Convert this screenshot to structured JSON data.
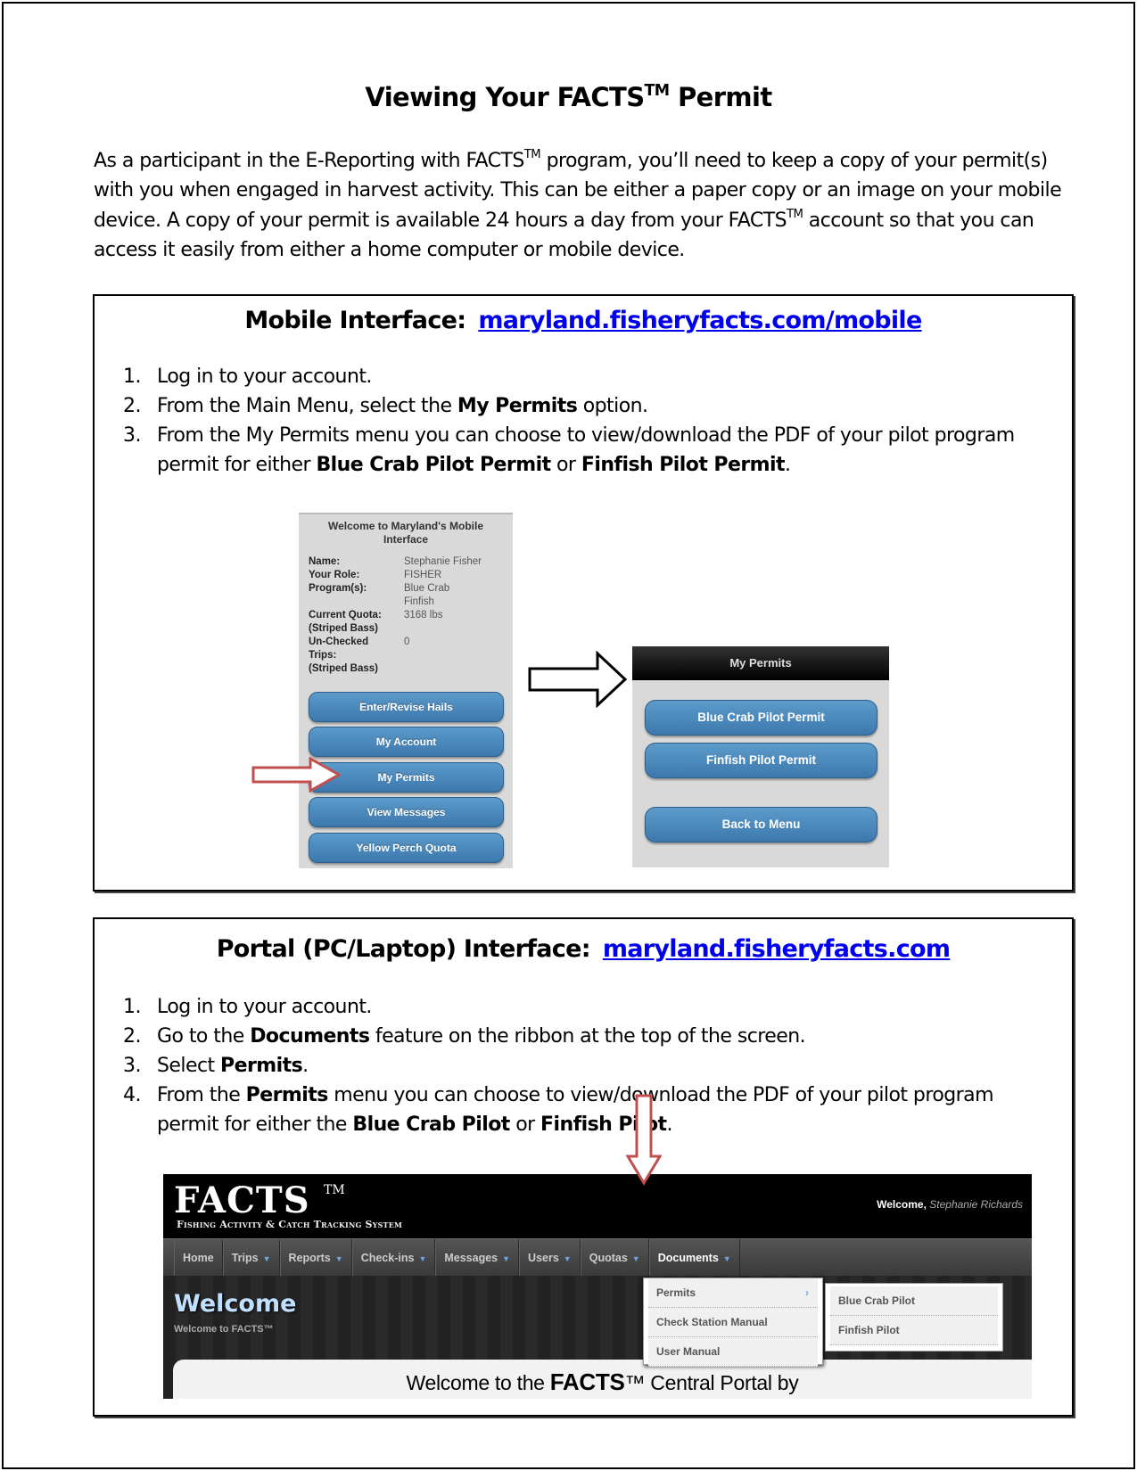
{
  "title": {
    "text": "Viewing Your FACTS",
    "tm": "TM",
    "suffix": " Permit"
  },
  "intro": {
    "p1": "As a participant in the E-Reporting with FACTS",
    "tm": "TM",
    "p2": " program, you’ll need to keep a copy of your permit(s) with you when engaged in harvest activity.  This can be either a paper copy or an image on your mobile device.  A copy of your permit is available 24 hours a day from your FACTS",
    "p3": " account so that you can access it easily from either a home computer or mobile device."
  },
  "mobile": {
    "heading": "Mobile Interface:",
    "link": "maryland.fisheryfacts.com/mobile",
    "steps": [
      {
        "num": "1.",
        "text": "Log in to your account."
      },
      {
        "num": "2.",
        "a": "From the Main Menu, select the ",
        "b": "My Permits",
        "c": " option."
      },
      {
        "num": "3.",
        "a": "From the My Permits menu you can choose to view/download the PDF of your pilot program permit for either ",
        "b": "Blue Crab Pilot Permit",
        "c": " or ",
        "d": "Finfish Pilot Permit",
        "e": "."
      }
    ],
    "screen1": {
      "title": "Welcome to Maryland's Mobile Interface",
      "info": [
        {
          "label": "Name:",
          "value": "Stephanie Fisher"
        },
        {
          "label": "Your Role:",
          "value": "FISHER"
        },
        {
          "label": "Program(s):",
          "value": "Blue Crab"
        },
        {
          "label": "",
          "value": "Finfish"
        },
        {
          "label": "Current Quota:",
          "value": "3168 lbs"
        },
        {
          "label": "(Striped Bass)",
          "value": ""
        },
        {
          "label": "Un-Checked",
          "value": "0"
        },
        {
          "label": "Trips:",
          "value": ""
        },
        {
          "label": "(Striped Bass)",
          "value": ""
        }
      ],
      "buttons": [
        "Enter/Revise Hails",
        "My Account",
        "My Permits",
        "View Messages",
        "Yellow Perch Quota"
      ]
    },
    "screen2": {
      "title": "My Permits",
      "buttons": [
        "Blue Crab Pilot Permit",
        "Finfish Pilot Permit",
        "Back to Menu"
      ]
    }
  },
  "portal": {
    "heading": "Portal (PC/Laptop) Interface:",
    "link": "maryland.fisheryfacts.com",
    "steps": [
      {
        "num": "1.",
        "text": "Log in to your account."
      },
      {
        "num": "2.",
        "a": "Go to the ",
        "b": "Documents",
        "c": " feature on the ribbon at the top of the screen."
      },
      {
        "num": "3.",
        "a": "Select ",
        "b": "Permits",
        "c": "."
      },
      {
        "num": "4.",
        "a": "From the ",
        "b": "Permits",
        "c": " menu you can choose to view/download the PDF of your pilot program permit for either the ",
        "d": "Blue Crab Pilot",
        "e": " or ",
        "f": "Finfish Pilot",
        "g": "."
      }
    ],
    "screen": {
      "logo": "FACTS",
      "logo_tm": "TM",
      "tagline": "Fishing Activity & Catch Tracking System",
      "welcome_label": "Welcome, ",
      "welcome_user": "Stephanie Richards",
      "nav": [
        {
          "label": "Home",
          "dropdown": false
        },
        {
          "label": "Trips",
          "dropdown": true
        },
        {
          "label": "Reports",
          "dropdown": true
        },
        {
          "label": "Check-ins",
          "dropdown": true
        },
        {
          "label": "Messages",
          "dropdown": true
        },
        {
          "label": "Users",
          "dropdown": true
        },
        {
          "label": "Quotas",
          "dropdown": true
        },
        {
          "label": "Documents",
          "dropdown": true,
          "active": true
        }
      ],
      "hero_title": "Welcome",
      "hero_subtitle": "Welcome to FACTS™",
      "content_pre": "Welcome to the ",
      "content_bold": "FACTS",
      "content_post": "™ Central Portal by",
      "documents_menu": [
        "Permits",
        "Check Station Manual",
        "User Manual"
      ],
      "permits_submenu": [
        "Blue Crab Pilot",
        "Finfish Pilot"
      ]
    }
  },
  "colors": {
    "link": "#0000ee",
    "button_blue": "#4a88be",
    "arrow_red": "#c0504d",
    "nav_chevron": "#6fa2e6"
  }
}
